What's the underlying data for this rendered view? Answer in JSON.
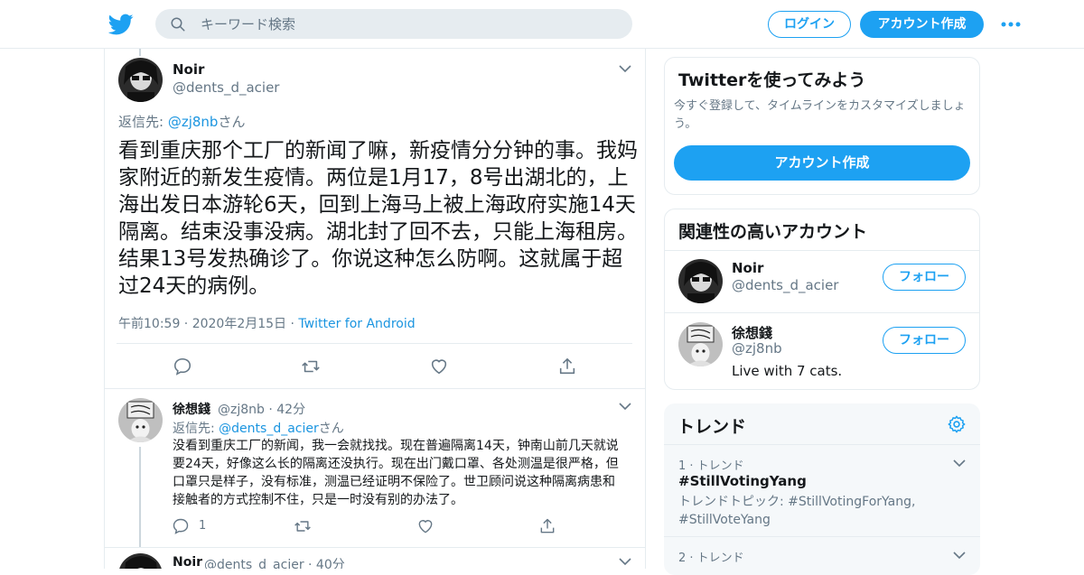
{
  "header": {
    "search_placeholder": "キーワード検索",
    "login": "ログイン",
    "signup": "アカウント作成"
  },
  "main_tweet": {
    "name": "Noir",
    "handle": "@dents_d_acier",
    "reply_prefix": "返信先: ",
    "reply_to": "@zj8nb",
    "reply_suffix": "さん",
    "text": "看到重庆那个工厂的新闻了嘛，新疫情分分钟的事。我妈家附近的新发生疫情。两位是1月17，8号出湖北的，上海出发日本游轮6天，回到上海马上被上海政府实施14天隔离。结束没事没病。湖北封了回不去，只能上海租房。结果13号发热确诊了。你说这种怎么防啊。这就属于超过24天的病例。",
    "time": "午前10:59 · 2020年2月15日 · ",
    "source": "Twitter for Android"
  },
  "reply1": {
    "name": "徐想錢",
    "handle": "@zj8nb",
    "age": " · 42分",
    "reply_prefix": "返信先: ",
    "reply_to": "@dents_d_acier",
    "reply_suffix": "さん",
    "text": "没看到重庆工厂的新闻，我一会就找找。现在普遍隔离14天，钟南山前几天就说要24天，好像这么长的隔离还没执行。现在出门戴口罩、各处测温是很严格，但口罩只是样子，没有标准，测温已经证明不保险了。世卫顾问说这种隔离病患和接触者的方式控制不住，只是一时没有别的办法了。",
    "reply_count": "1"
  },
  "reply2": {
    "name": "Noir",
    "handle": "@dents_d_acier",
    "age": " · 40分"
  },
  "signup_card": {
    "title": "Twitterを使ってみよう",
    "subtitle": "今すぐ登録して、タイムラインをカスタマイズしましょう。",
    "button": "アカウント作成"
  },
  "related": {
    "title": "関連性の高いアカウント",
    "follow_label": "フォロー",
    "accounts": [
      {
        "name": "Noir",
        "handle": "@dents_d_acier",
        "bio": ""
      },
      {
        "name": "徐想錢",
        "handle": "@zj8nb",
        "bio": "Live with 7 cats."
      }
    ]
  },
  "trends": {
    "title": "トレンド",
    "items": [
      {
        "rank": "1 · トレンド",
        "name": "#StillVotingYang",
        "topic": "トレンドトピック: #StillVotingForYang, #StillVoteYang"
      },
      {
        "rank": "2 · トレンド",
        "name": "",
        "topic": ""
      }
    ]
  },
  "colors": {
    "accent": "#1da1f2",
    "link": "#1b95e0",
    "muted": "#657786",
    "border": "#e6ecf0"
  }
}
